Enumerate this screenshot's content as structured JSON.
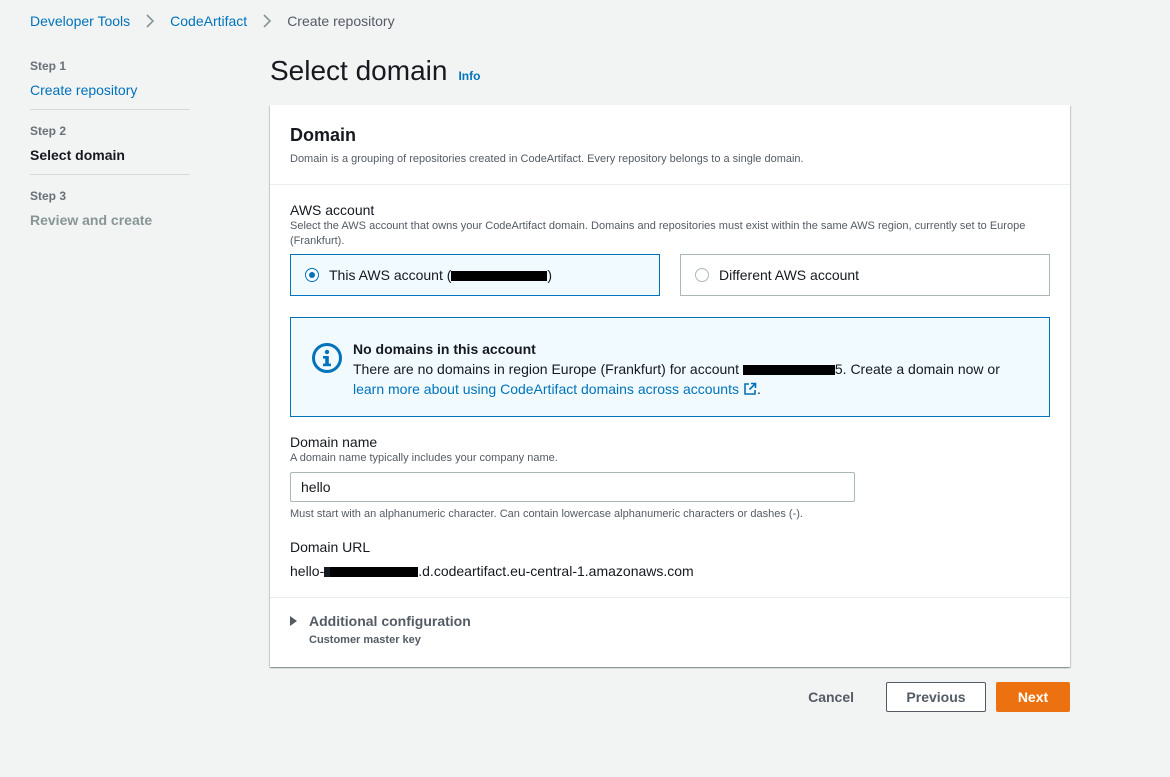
{
  "breadcrumb": {
    "items": [
      "Developer Tools",
      "CodeArtifact"
    ],
    "current": "Create repository"
  },
  "steps": [
    {
      "number": "Step 1",
      "title": "Create repository"
    },
    {
      "number": "Step 2",
      "title": "Select domain"
    },
    {
      "number": "Step 3",
      "title": "Review and create"
    }
  ],
  "page": {
    "title": "Select domain",
    "info": "Info"
  },
  "domain_container": {
    "title": "Domain",
    "description": "Domain is a grouping of repositories created in CodeArtifact. Every repository belongs to a single domain."
  },
  "aws_account": {
    "label": "AWS account",
    "description": "Select the AWS account that owns your CodeArtifact domain. Domains and repositories must exist within the same AWS region, currently set to Europe (Frankfurt).",
    "option_this_prefix": "This AWS account (",
    "option_this_suffix": ")",
    "option_different": "Different AWS account",
    "selected": "this"
  },
  "alert": {
    "title": "No domains in this account",
    "body_prefix": "There are no domains in region Europe (Frankfurt) for account ",
    "body_suffix": ". Create a domain now or",
    "link": "learn more about using CodeArtifact domains across accounts",
    "end": ".",
    "account_tail": "5"
  },
  "domain_name": {
    "label": "Domain name",
    "description": "A domain name typically includes your company name.",
    "value": "hello",
    "constraint": "Must start with an alphanumeric character. Can contain lowercase alphanumeric characters or dashes (-)."
  },
  "domain_url": {
    "label": "Domain URL",
    "prefix": "hello-",
    "suffix": ".d.codeartifact.eu-central-1.amazonaws.com"
  },
  "additional_config": {
    "title": "Additional configuration",
    "description": "Customer master key"
  },
  "actions": {
    "cancel": "Cancel",
    "previous": "Previous",
    "next": "Next"
  },
  "colors": {
    "link": "#0073bb",
    "primary_button": "#ec7211",
    "background": "#f2f3f3"
  }
}
